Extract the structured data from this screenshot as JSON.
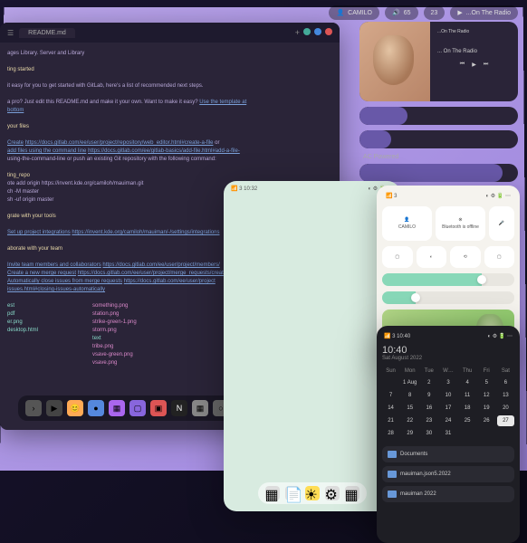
{
  "topbar": {
    "user": "CAMILO",
    "battery": "65",
    "volume": "23",
    "nowplaying": "...On The Radio"
  },
  "editor": {
    "tab": "README.md",
    "lines": {
      "l1": "ages Library. Server and Library",
      "l2": "ting started",
      "l3": "it easy for you to get started with GitLab, here's a list of recommended next steps.",
      "l4a": "a pro? Just edit this README.md and make it your own. Want to make it easy? ",
      "l4b": "Use the template at",
      "l5": "your files",
      "l6a": "Create",
      "l6b": "https://docs.gitlab.com/ee/user/project/repository/web_editor.html#create-a-file",
      "l6c": " or ",
      "l7a": "add files using the command line",
      "l7b": "https://docs.gitlab.com/ee/gitlab-basics/add-file.html#add-a-file-",
      "l8": "using-the-command-line or push an existing Git repository with the following command:",
      "l9": "ting_repo",
      "l10": "ote add origin https://invent.kde.org/camiloh/mauiman.git",
      "l11": "ch -M master",
      "l12": "sh -uf origin master",
      "l13": "grate with your tools",
      "l14a": "Set up project integrations",
      "l14b": "https://invent.kde.org/camiloh/mauiman/-/settings/integrations",
      "l15": "aborate with your team",
      "l16a": "Invite team members and collaborators",
      "l16b": "https://docs.gitlab.com/ee/user/project/members/",
      "l17a": "Create a new merge request",
      "l17b": "https://docs.gitlab.com/ee/user/project/merge_requests/creat",
      "l18a": "Automatically close issues from merge requests",
      "l18b": "https://docs.gitlab.com/ee/user/project",
      "l19": "issues.html#closing-issues-automatically",
      "files_left": [
        "est",
        "pdf",
        "er.png",
        "desktop.html"
      ],
      "files_right": [
        "something.png",
        "station.png",
        "strike-green-1.png",
        "storm.png",
        "text",
        "tribe.png",
        "vsave-green.png",
        "vsave.png"
      ]
    }
  },
  "music": {
    "artist": "...On The Radio",
    "track": "... On The Radio"
  },
  "ac_label": "AC Powered",
  "mobile_light": {
    "time": "10:32"
  },
  "panel_light": {
    "user": "CAMILO",
    "bt": "Bluetooth is offline"
  },
  "mobile_dark": {
    "status_time": "10:40",
    "clock": "10:40",
    "date": "Sat August 2022",
    "days": [
      "Sun",
      "Mon",
      "Tue",
      "W…",
      "Thu",
      "Fri",
      "Sat"
    ],
    "weeks": [
      [
        "",
        "1 Aug",
        "2",
        "3",
        "4",
        "5",
        "6"
      ],
      [
        "7",
        "8",
        "9",
        "10",
        "11",
        "12",
        "13"
      ],
      [
        "14",
        "15",
        "16",
        "17",
        "18",
        "19",
        "20"
      ],
      [
        "21",
        "22",
        "23",
        "24",
        "25",
        "26",
        "27"
      ],
      [
        "28",
        "29",
        "30",
        "31",
        "",
        "",
        ""
      ]
    ],
    "today": "27",
    "files": [
      "Documents",
      "mauiman.json5.2022",
      "mauiman 2022"
    ]
  }
}
